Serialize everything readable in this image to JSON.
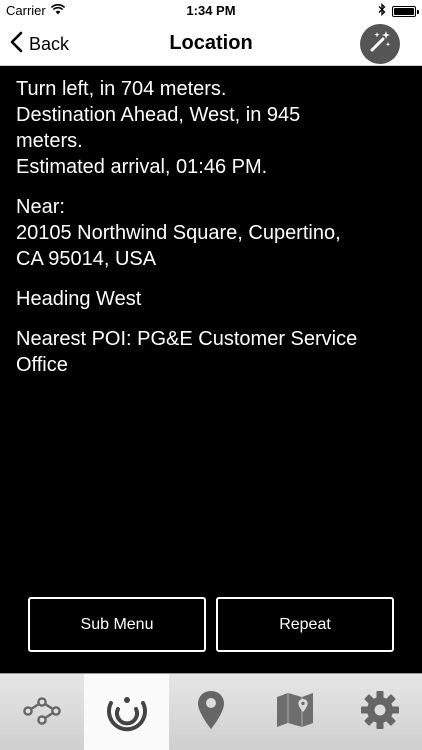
{
  "status_bar": {
    "carrier": "Carrier",
    "time": "1:34 PM"
  },
  "nav": {
    "back_label": "Back",
    "title": "Location",
    "action_icon": "magic-wand-icon"
  },
  "content": {
    "route": [
      "Turn left, in 704 meters.",
      "Destination Ahead, West, in 945",
      "meters.",
      "Estimated arrival, 01:46 PM."
    ],
    "near_label": "Near:",
    "address": [
      "20105 Northwind Square, Cupertino,",
      "CA 95014, USA"
    ],
    "heading": "Heading West",
    "poi": [
      "Nearest POI: PG&E Customer Service",
      "Office"
    ]
  },
  "actions": {
    "sub_menu_label": "Sub Menu",
    "repeat_label": "Repeat"
  },
  "tabs": [
    {
      "icon": "route-icon",
      "selected": false
    },
    {
      "icon": "location-radar-icon",
      "selected": true
    },
    {
      "icon": "map-pin-icon",
      "selected": false
    },
    {
      "icon": "map-icon",
      "selected": false
    },
    {
      "icon": "gear-icon",
      "selected": false
    }
  ],
  "colors": {
    "background": "#000000",
    "text": "#ffffff",
    "tab_icon": "#666666"
  }
}
